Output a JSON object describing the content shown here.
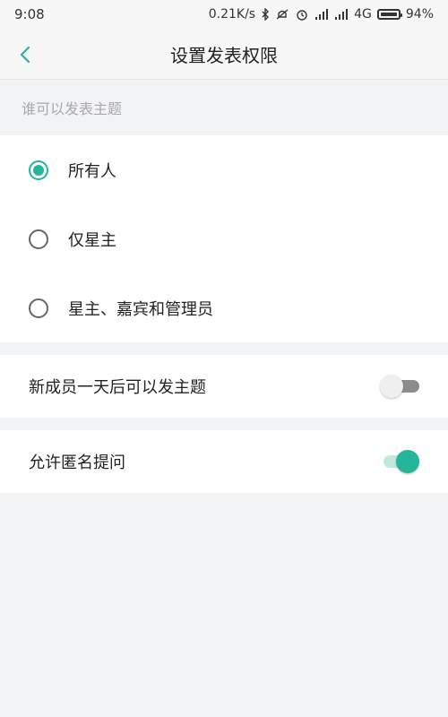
{
  "status": {
    "time": "9:08",
    "speed": "0.21K/s",
    "network": "4G",
    "battery": "94%",
    "icons": [
      "bluetooth-icon",
      "silent-icon",
      "alarm-icon",
      "signal-icon",
      "signal-icon",
      "battery-icon"
    ]
  },
  "header": {
    "title": "设置发表权限",
    "back_icon": "chevron-left-icon",
    "accent": "#25b59b"
  },
  "permission": {
    "section_label": "谁可以发表主题",
    "options": [
      {
        "label": "所有人",
        "selected": true
      },
      {
        "label": "仅星主",
        "selected": false
      },
      {
        "label": "星主、嘉宾和管理员",
        "selected": false
      }
    ]
  },
  "settings": {
    "new_member_label": "新成员一天后可以发主题",
    "new_member_enabled": false,
    "anonymous_label": "允许匿名提问",
    "anonymous_enabled": true
  }
}
